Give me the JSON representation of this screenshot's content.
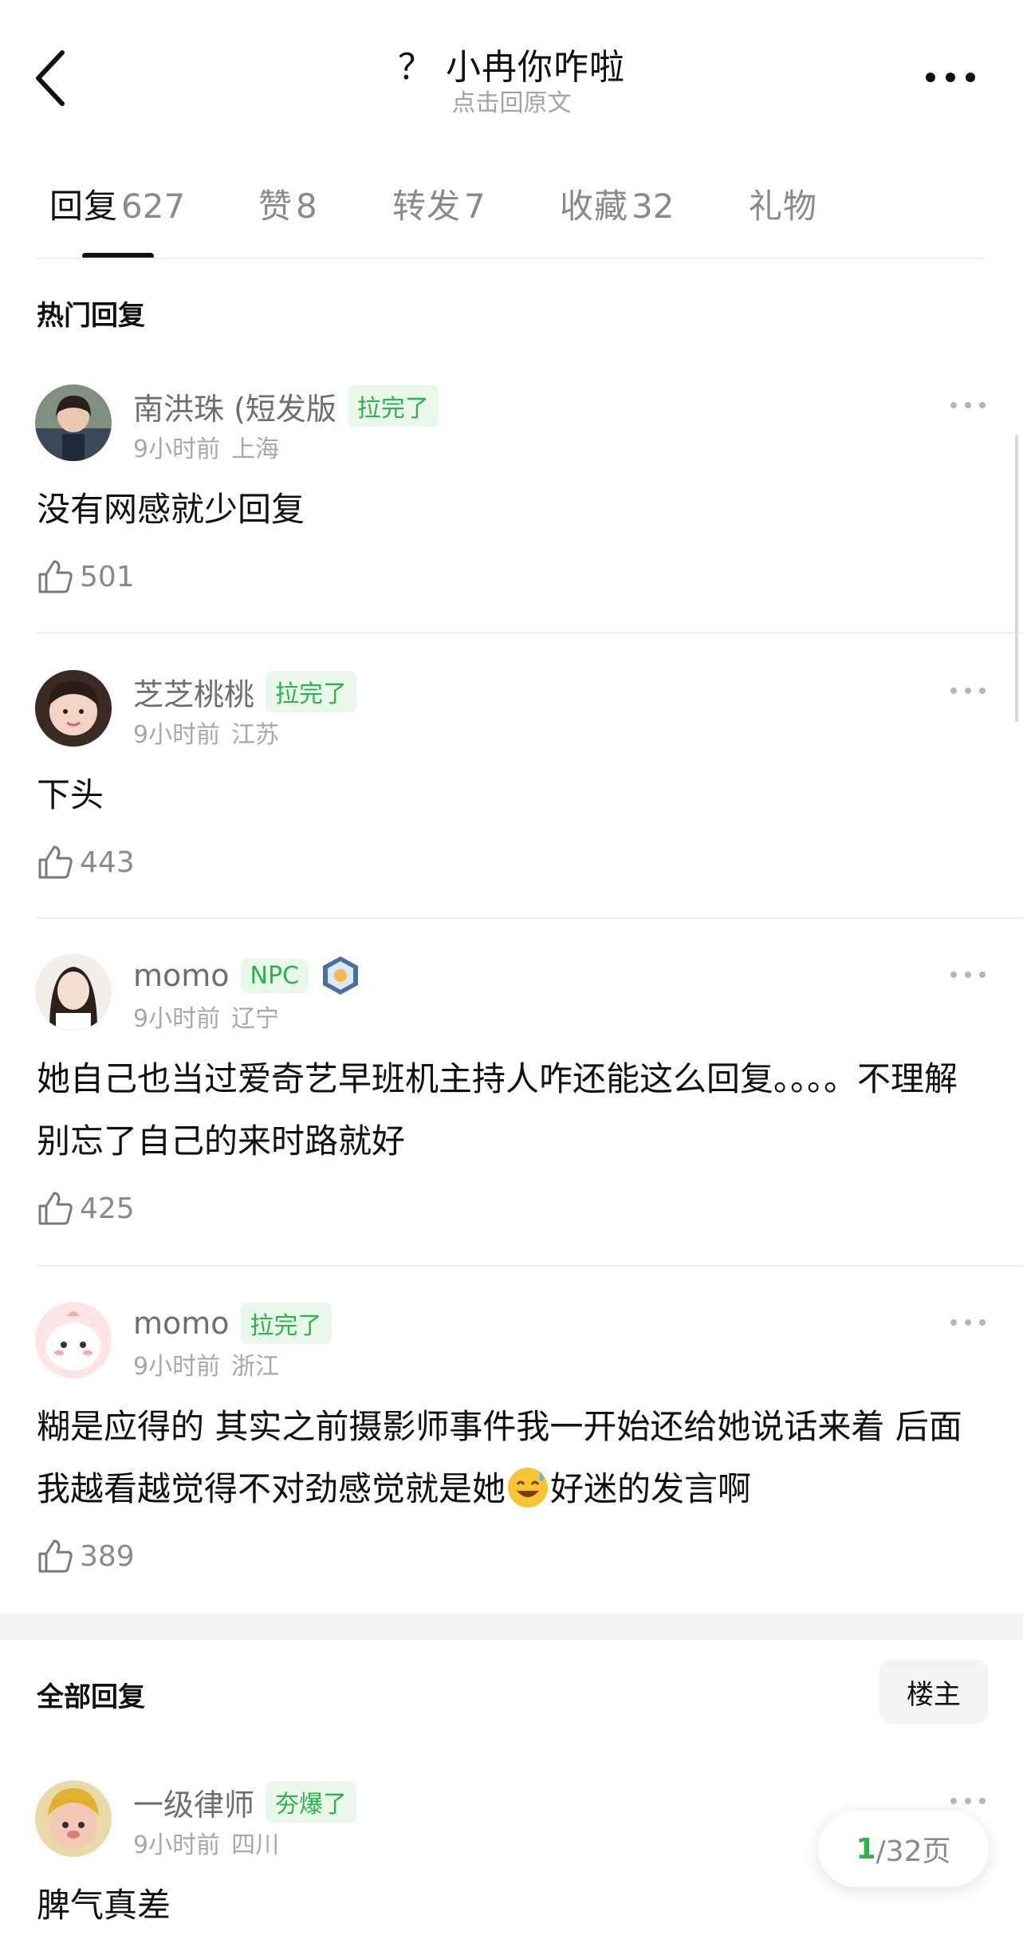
{
  "header": {
    "title": "？ 小冉你咋啦",
    "subtitle": "点击回原文"
  },
  "tabs": [
    {
      "label": "回复",
      "count": "627"
    },
    {
      "label": "赞",
      "count": "8"
    },
    {
      "label": "转发",
      "count": "7"
    },
    {
      "label": "收藏",
      "count": "32"
    },
    {
      "label": "礼物",
      "count": ""
    }
  ],
  "hot_section_title": "热门回复",
  "hot_comments": [
    {
      "username": "南洪珠 (短发版",
      "badge": "拉完了",
      "time": "9小时前",
      "location": "上海",
      "text": "没有网感就少回复",
      "likes": "501"
    },
    {
      "username": "芝芝桃桃",
      "badge": "拉完了",
      "time": "9小时前",
      "location": "江苏",
      "text": "下头",
      "likes": "443"
    },
    {
      "username": "momo",
      "badge": "NPC",
      "time": "9小时前",
      "location": "辽宁",
      "text": "她自己也当过爱奇艺早班机主持人咋还能这么回复。。。。不理解 别忘了自己的来时路就好",
      "likes": "425"
    },
    {
      "username": "momo",
      "badge": "拉完了",
      "time": "9小时前",
      "location": "浙江",
      "text_before": "糊是应得的 其实之前摄影师事件我一开始还给她说话来着 后面我越看越觉得不对劲感觉就是她",
      "text_after": "好迷的发言啊",
      "likes": "389"
    }
  ],
  "all_section_title": "全部回复",
  "op_button": "楼主",
  "all_comments": [
    {
      "username": "一级律师",
      "badge": "夯爆了",
      "time": "9小时前",
      "location": "四川",
      "text": "脾气真差"
    }
  ],
  "pager": {
    "current": "1",
    "total_text": "/32页"
  },
  "colors": {
    "accent_green": "#2fb24a",
    "badge_bg": "#eaf8ec",
    "text_gray": "#8a8a8a"
  },
  "icons": [
    "back-icon",
    "more-icon",
    "thumb-up-icon",
    "sweat-smile-emoji"
  ]
}
